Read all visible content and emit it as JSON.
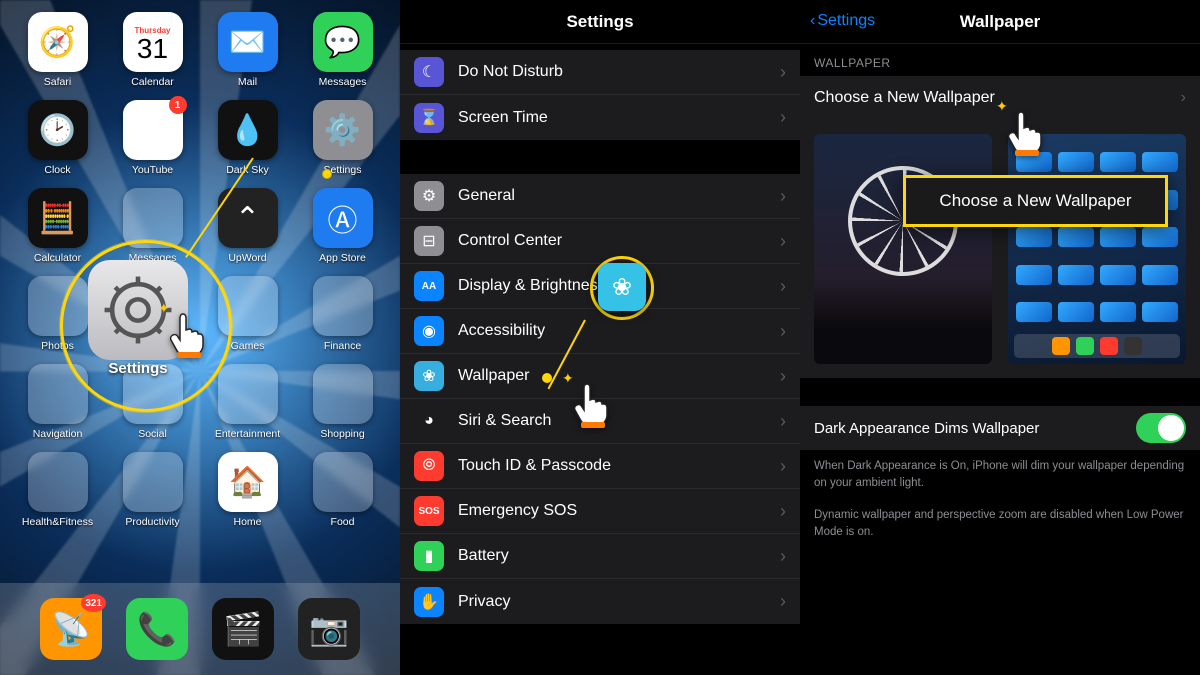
{
  "panel1": {
    "apps": [
      {
        "label": "Safari",
        "icon": "safari",
        "bg": "bg-white"
      },
      {
        "label": "Calendar",
        "icon": "calendar",
        "bg": "bg-white",
        "day": "Thursday",
        "date": "31"
      },
      {
        "label": "Mail",
        "icon": "mail",
        "bg": "bg-blue"
      },
      {
        "label": "Messages",
        "icon": "messages",
        "bg": "bg-green"
      },
      {
        "label": "Clock",
        "icon": "clock",
        "bg": "bg-black"
      },
      {
        "label": "YouTube",
        "icon": "youtube",
        "bg": "bg-white",
        "badge": "1"
      },
      {
        "label": "Dark Sky",
        "icon": "darksky",
        "bg": "bg-black"
      },
      {
        "label": "Settings",
        "icon": "settings",
        "bg": "bg-gray"
      },
      {
        "label": "Calculator",
        "icon": "calc",
        "bg": "bg-black"
      },
      {
        "label": "Messages",
        "icon": "folder",
        "bg": "folder"
      },
      {
        "label": "UpWord",
        "icon": "upword",
        "bg": "bg-dark"
      },
      {
        "label": "App Store",
        "icon": "appstore",
        "bg": "bg-blue"
      },
      {
        "label": "Photos",
        "icon": "folder",
        "bg": "folder"
      },
      {
        "label": "Games",
        "icon": "folder",
        "bg": "folder"
      },
      {
        "label": "Games",
        "icon": "folder",
        "bg": "folder"
      },
      {
        "label": "Finance",
        "icon": "folder",
        "bg": "folder"
      },
      {
        "label": "Navigation",
        "icon": "folder",
        "bg": "folder"
      },
      {
        "label": "Social",
        "icon": "folder",
        "bg": "folder"
      },
      {
        "label": "Entertainment",
        "icon": "folder",
        "bg": "folder"
      },
      {
        "label": "Shopping",
        "icon": "folder",
        "bg": "folder"
      },
      {
        "label": "Health&Fitness",
        "icon": "folder",
        "bg": "folder"
      },
      {
        "label": "Productivity",
        "icon": "folder",
        "bg": "folder"
      },
      {
        "label": "Home",
        "icon": "home",
        "bg": "bg-white"
      },
      {
        "label": "Food",
        "icon": "folder",
        "bg": "folder"
      }
    ],
    "zoom_label": "Settings",
    "dock": [
      {
        "icon": "overcast",
        "bg": "bg-orange",
        "badge": "321"
      },
      {
        "icon": "phone",
        "bg": "bg-green"
      },
      {
        "icon": "movie",
        "bg": "bg-black"
      },
      {
        "icon": "camera",
        "bg": "bg-dark"
      }
    ]
  },
  "panel2": {
    "title": "Settings",
    "group1": [
      {
        "label": "Do Not Disturb",
        "bg": "#5856d6",
        "glyph": "☾"
      },
      {
        "label": "Screen Time",
        "bg": "#5856d6",
        "glyph": "⌛"
      }
    ],
    "group2": [
      {
        "label": "General",
        "bg": "#8e8e93",
        "glyph": "⚙"
      },
      {
        "label": "Control Center",
        "bg": "#8e8e93",
        "glyph": "⊟"
      },
      {
        "label": "Display & Brightness",
        "bg": "#0a84ff",
        "glyph": "AA"
      },
      {
        "label": "Accessibility",
        "bg": "#0a84ff",
        "glyph": "◉"
      },
      {
        "label": "Wallpaper",
        "bg": "#36aee0",
        "glyph": "❀"
      },
      {
        "label": "Siri & Search",
        "bg": "#1c1c1e",
        "glyph": "◕"
      },
      {
        "label": "Touch ID & Passcode",
        "bg": "#ff3b30",
        "glyph": "⦾"
      },
      {
        "label": "Emergency SOS",
        "bg": "#ff3b30",
        "glyph": "SOS"
      },
      {
        "label": "Battery",
        "bg": "#30d158",
        "glyph": "▮"
      },
      {
        "label": "Privacy",
        "bg": "#0a84ff",
        "glyph": "✋"
      }
    ]
  },
  "panel3": {
    "back": "Settings",
    "title": "Wallpaper",
    "header": "WALLPAPER",
    "choose": "Choose a New Wallpaper",
    "callout": "Choose a New Wallpaper",
    "switch_label": "Dark Appearance Dims Wallpaper",
    "footer1": "When Dark Appearance is On, iPhone will dim your wallpaper depending on your ambient light.",
    "footer2": "Dynamic wallpaper and perspective zoom are disabled when Low Power Mode is on."
  }
}
